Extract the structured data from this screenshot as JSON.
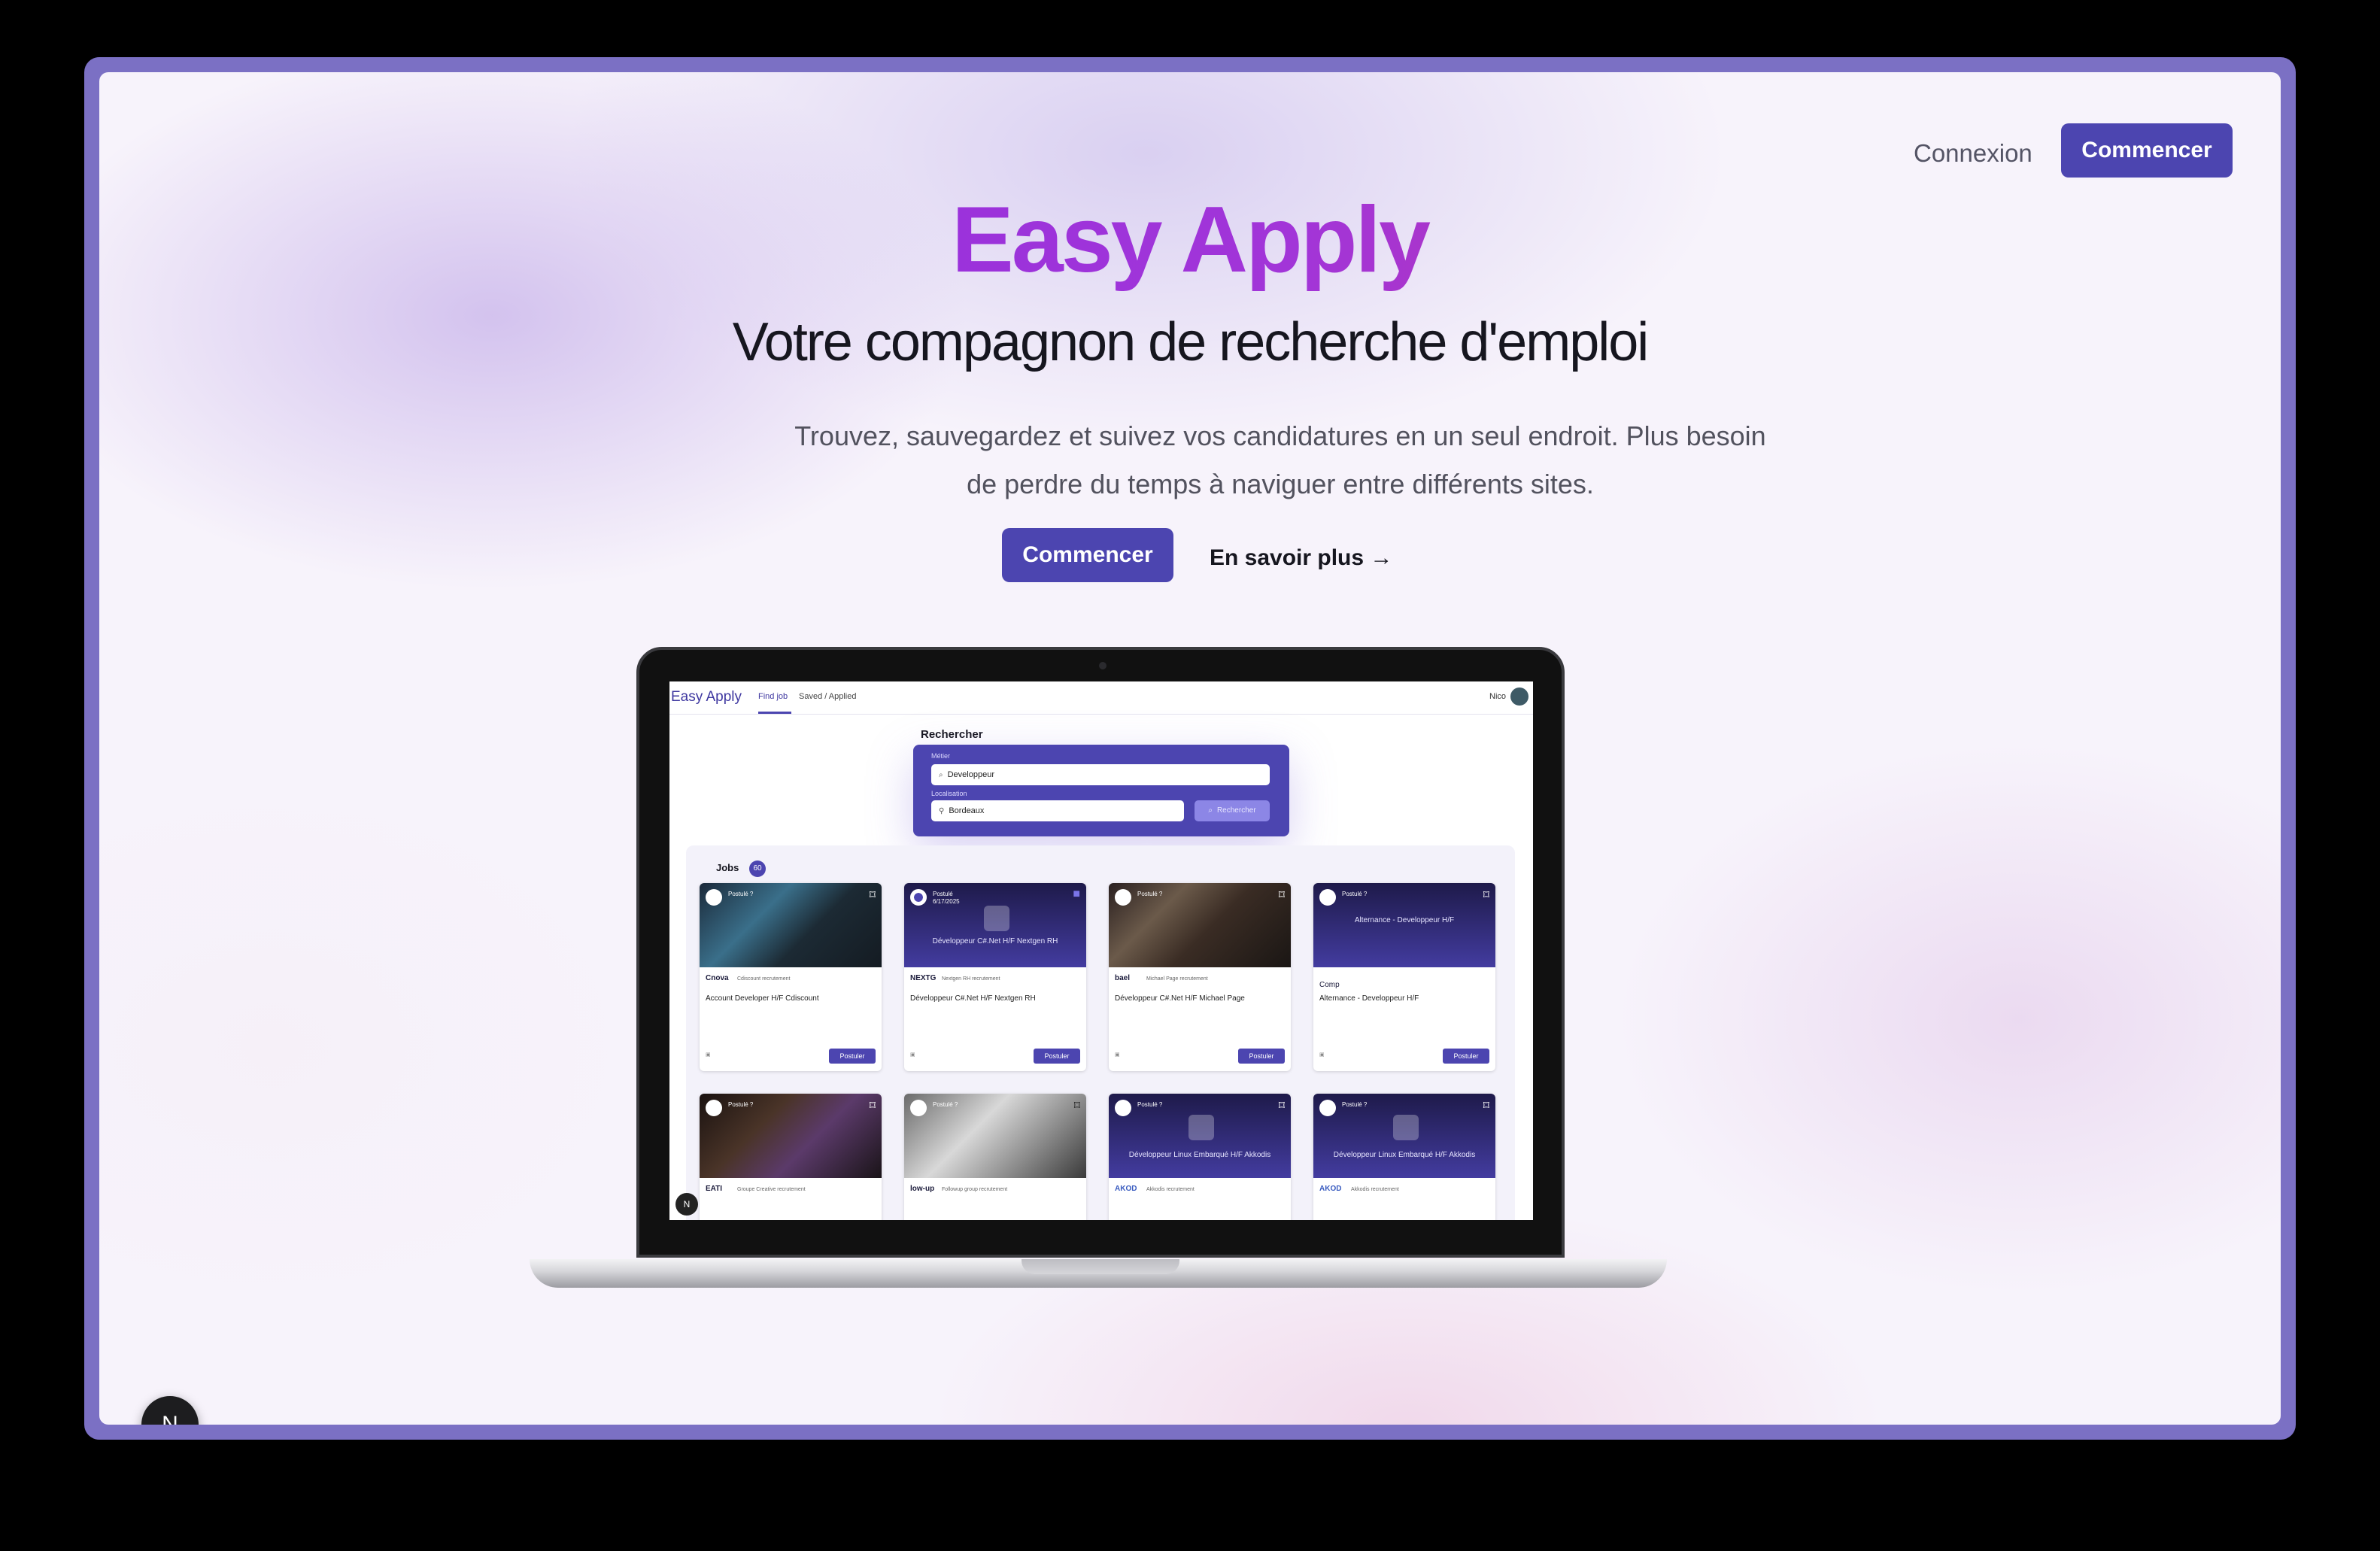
{
  "nav": {
    "login_label": "Connexion",
    "start_label": "Commencer"
  },
  "hero": {
    "title": "Easy Apply",
    "subtitle": "Votre compagnon de recherche d'emploi",
    "description": "Trouvez, sauvegardez et suivez vos candidatures en un seul endroit. Plus besoin de perdre du temps à naviguer entre différents sites.",
    "cta_primary": "Commencer",
    "cta_secondary": "En savoir plus →"
  },
  "screen": {
    "app_name": "Easy Apply",
    "tabs": [
      "Find job",
      "Saved / Applied"
    ],
    "user_name": "Nico",
    "search": {
      "title": "Rechercher",
      "job_label": "Métier",
      "job_value": "Developpeur",
      "location_label": "Localisation",
      "location_value": "Bordeaux",
      "button_label": "Rechercher"
    },
    "jobs": {
      "title": "Jobs",
      "count": "60",
      "cards": [
        {
          "status": "Postulé ?",
          "date": "",
          "company": "Cdiscount recrutement",
          "logo": "Cnova",
          "title": "Account Developer H/F Cdiscount",
          "image_text": "",
          "apply": "Postuler"
        },
        {
          "status": "Postulé",
          "date": "6/17/2025",
          "company": "Nextgen RH recrutement",
          "logo": "NEXTG",
          "title": "Développeur C#.Net H/F Nextgen RH",
          "image_text": "Développeur C#.Net H/F Nextgen RH",
          "apply": "Postuler"
        },
        {
          "status": "Postulé ?",
          "date": "",
          "company": "Michael Page recrutement",
          "logo": "bael",
          "title": "Développeur C#.Net H/F Michael Page",
          "image_text": "",
          "apply": "Postuler"
        },
        {
          "status": "Postulé ?",
          "date": "",
          "company": "",
          "logo": "Comp",
          "title": "Alternance - Developpeur H/F",
          "image_text": "Alternance - Developpeur H/F",
          "apply": "Postuler"
        },
        {
          "status": "Postulé ?",
          "date": "",
          "company": "Groupe Creative recrutement",
          "logo": "EATI",
          "title": "",
          "image_text": "",
          "apply": ""
        },
        {
          "status": "Postulé ?",
          "date": "",
          "company": "Followup group recrutement",
          "logo": "low-up",
          "title": "",
          "image_text": "",
          "apply": ""
        },
        {
          "status": "Postulé ?",
          "date": "",
          "company": "Akkodis recrutement",
          "logo": "AKOD",
          "title": "",
          "image_text": "Développeur Linux Embarqué H/F Akkodis",
          "apply": ""
        },
        {
          "status": "Postulé ?",
          "date": "",
          "company": "Akkodis recrutement",
          "logo": "AKOD",
          "title": "",
          "image_text": "Développeur Linux Embarqué H/F Akkodis",
          "apply": ""
        }
      ]
    }
  },
  "badge": {
    "label": "N"
  },
  "colors": {
    "accent": "#4c45b0",
    "title_gradient_start": "#8a2be2",
    "title_gradient_end": "#d4377f",
    "frame": "#7b70c4"
  }
}
